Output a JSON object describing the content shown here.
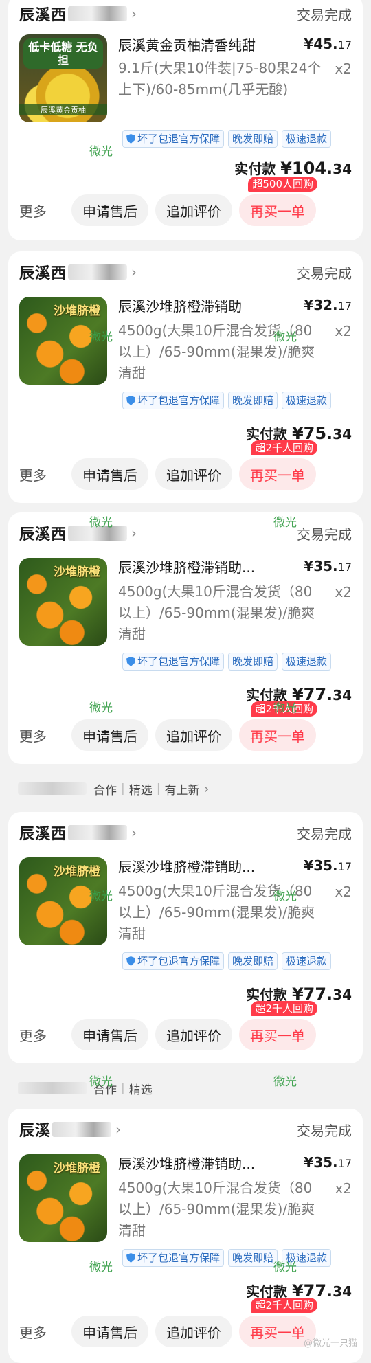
{
  "accent_color": "#ff3b4a",
  "watermark": "微光",
  "orders": [
    {
      "store": "辰溪西",
      "status": "交易完成",
      "thumb_banner": "低卡低糖 无负担",
      "thumb_sub": "辰溪黄金贡柚",
      "title": "辰溪黄金贡柚清香纯甜",
      "price_int": "¥45.",
      "price_dec": "17",
      "spec": "9.1斤(大果10件装|75-80果24个上下)/60-85mm(几乎无酸)",
      "qty": "x2",
      "tags": [
        "坏了包退官方保障",
        "晚发即赔",
        "极速退款"
      ],
      "paid_label": "实付款",
      "paid_int": "¥104.",
      "paid_dec": "34",
      "more": "更多",
      "btn_aftersale": "申请售后",
      "btn_review": "追加评价",
      "btn_rebuy": "再买一单",
      "badge": "超500人回购"
    },
    {
      "store": "辰溪西",
      "status": "交易完成",
      "thumb_banner": "沙堆脐橙",
      "thumb_sub": "",
      "title": "辰溪沙堆脐橙滞销助",
      "price_int": "¥32.",
      "price_dec": "17",
      "spec": "4500g(大果10斤混合发货（80以上）/65-90mm(混果发)/脆爽清甜",
      "qty": "x2",
      "tags": [
        "坏了包退官方保障",
        "晚发即赔",
        "极速退款"
      ],
      "paid_label": "实付款",
      "paid_int": "¥75.",
      "paid_dec": "34",
      "more": "更多",
      "btn_aftersale": "申请售后",
      "btn_review": "追加评价",
      "btn_rebuy": "再买一单",
      "badge": "超2千人回购"
    },
    {
      "store": "辰溪西",
      "status": "交易完成",
      "thumb_banner": "沙堆脐橙",
      "thumb_sub": "",
      "title": "辰溪沙堆脐橙滞销助...",
      "price_int": "¥35.",
      "price_dec": "17",
      "spec": "4500g(大果10斤混合发货（80以上）/65-90mm(混果发)/脆爽清甜",
      "qty": "x2",
      "tags": [
        "坏了包退官方保障",
        "晚发即赔",
        "极速退款"
      ],
      "paid_label": "实付款",
      "paid_int": "¥77.",
      "paid_dec": "34",
      "more": "更多",
      "btn_aftersale": "申请售后",
      "btn_review": "追加评价",
      "btn_rebuy": "再买一单",
      "badge": "超2千人回购"
    },
    {
      "store": "辰溪西",
      "status": "交易完成",
      "thumb_banner": "沙堆脐橙",
      "thumb_sub": "",
      "title": "辰溪沙堆脐橙滞销助...",
      "price_int": "¥35.",
      "price_dec": "17",
      "spec": "4500g(大果10斤混合发货（80以上）/65-90mm(混果发)/脆爽清甜",
      "qty": "x2",
      "tags": [
        "坏了包退官方保障",
        "晚发即赔",
        "极速退款"
      ],
      "paid_label": "实付款",
      "paid_int": "¥77.",
      "paid_dec": "34",
      "more": "更多",
      "btn_aftersale": "申请售后",
      "btn_review": "追加评价",
      "btn_rebuy": "再买一单",
      "badge": "超2千人回购"
    },
    {
      "store": "辰溪",
      "status": "交易完成",
      "thumb_banner": "沙堆脐橙",
      "thumb_sub": "",
      "title": "辰溪沙堆脐橙滞销助...",
      "price_int": "¥35.",
      "price_dec": "17",
      "spec": "4500g(大果10斤混合发货（80以上）/65-90mm(混果发)/脆爽清甜",
      "qty": "x2",
      "tags": [
        "坏了包退官方保障",
        "晚发即赔",
        "极速退款"
      ],
      "paid_label": "实付款",
      "paid_int": "¥77.",
      "paid_dec": "34",
      "more": "更多",
      "btn_aftersale": "申请售后",
      "btn_review": "追加评价",
      "btn_rebuy": "再买一单",
      "badge": "超2千人回购"
    }
  ],
  "rec_bars": [
    {
      "items": [
        "合作",
        "精选",
        "有上新"
      ]
    },
    {
      "items": [
        "合作",
        "精选"
      ]
    }
  ],
  "footer_watermark": "@微光一只猫"
}
